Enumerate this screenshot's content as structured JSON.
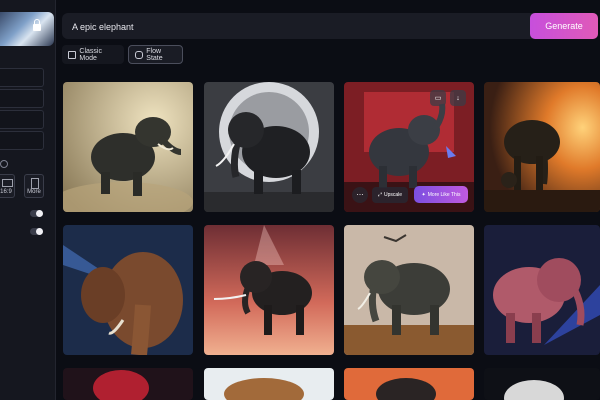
{
  "prompt": {
    "value": "A epic elephant",
    "generate_label": "Generate"
  },
  "modes": {
    "classic": "Classic Mode",
    "flow": "Flow State"
  },
  "sidebar": {
    "ratio_1": "16:9",
    "ratio_2": "More",
    "info": "i"
  },
  "overlay": {
    "more_dots": "⋯",
    "upscale": "Upscale",
    "more_like": "More Like This"
  },
  "icons": [
    "lock-icon",
    "info-icon",
    "classic-mode-icon",
    "flow-state-icon",
    "upscale-icon",
    "sparkle-icon",
    "image-icon",
    "download-icon"
  ],
  "colors": {
    "accent": "#d24fd0",
    "background": "#0b0d14",
    "panel": "#1a1c25"
  }
}
